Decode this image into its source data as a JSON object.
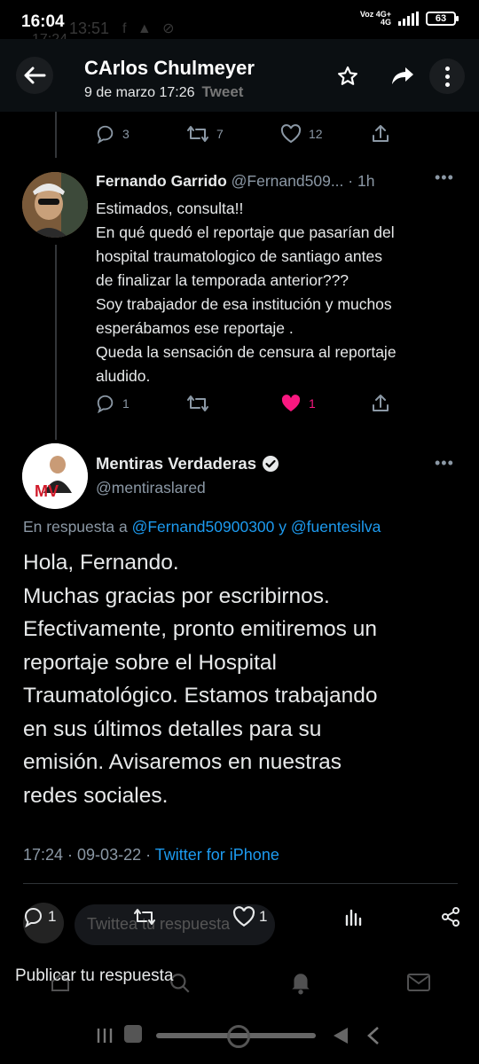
{
  "status_bar": {
    "time": "16:04",
    "ghost_time": "13:51",
    "ghost_time2": "17:24",
    "ghost_icons": "f ▲ ⊘",
    "net_top": "Voz 4G+",
    "net_bottom": "4G",
    "battery": "63"
  },
  "header": {
    "title": "CArlos Chulmeyer",
    "date": "9 de marzo 17:26",
    "tweet_word": "Tweet",
    "icons": [
      "back-arrow-icon",
      "star-icon",
      "share-icon",
      "more-vertical-icon"
    ]
  },
  "parent_actions": {
    "replies": "3",
    "retweets": "7",
    "likes": "12"
  },
  "reply_tweet": {
    "name": "Fernando Garrido",
    "handle": "@Fernand509...",
    "time": "· 1h",
    "lines": [
      "Estimados,  consulta!!",
      "En qué quedó el reportaje que pasarían del",
      "hospital traumatologico de santiago antes",
      "de finalizar la temporada anterior???",
      "Soy trabajador de esa institución y muchos",
      "esperábamos ese reportaje .",
      "Queda la sensación de censura al reportaje",
      "aludido."
    ],
    "actions": {
      "replies": "1",
      "likes": "1"
    },
    "like_color": "#f91880"
  },
  "main_tweet": {
    "name": "Mentiras Verdaderas",
    "handle": "@mentiraslared",
    "reply_prefix": "En respuesta a",
    "reply_user1": "@Fernand50900300",
    "reply_and": "y",
    "reply_user2": "@fuentesilva",
    "lines": [
      "Hola, Fernando.",
      "Muchas gracias por escribirnos.",
      "Efectivamente, pronto emitiremos un",
      "reportaje sobre el Hospital",
      "Traumatológico. Estamos trabajando",
      "en sus últimos detalles para su",
      "emisión. Avisaremos en nuestras",
      "redes sociales."
    ],
    "meta_time": "17:24 · 09-03-22 ·",
    "meta_source": "Twitter for iPhone",
    "avatar_logo": "MV"
  },
  "bottom_actions": {
    "replies": "1",
    "likes": "1"
  },
  "compose": {
    "placeholder": "Twittea tu respuesta"
  },
  "publish_label": "Publicar tu respuesta",
  "colors": {
    "link": "#1d9bf0",
    "verified": "#e7e9ea",
    "secondary": "#8b98a5"
  }
}
